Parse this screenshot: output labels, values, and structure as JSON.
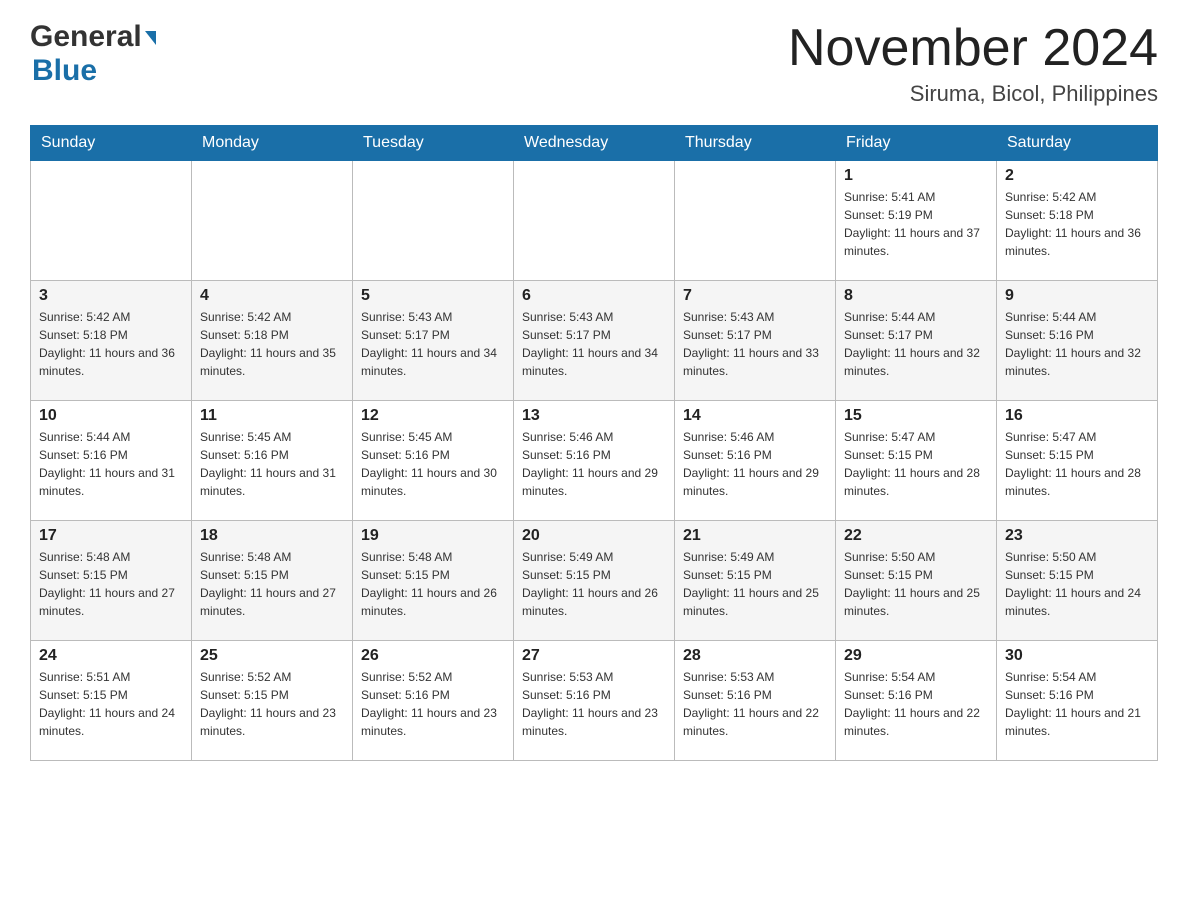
{
  "header": {
    "logo_general": "General",
    "logo_blue": "Blue",
    "month_title": "November 2024",
    "location": "Siruma, Bicol, Philippines"
  },
  "weekdays": [
    "Sunday",
    "Monday",
    "Tuesday",
    "Wednesday",
    "Thursday",
    "Friday",
    "Saturday"
  ],
  "weeks": [
    [
      {
        "day": "",
        "sunrise": "",
        "sunset": "",
        "daylight": ""
      },
      {
        "day": "",
        "sunrise": "",
        "sunset": "",
        "daylight": ""
      },
      {
        "day": "",
        "sunrise": "",
        "sunset": "",
        "daylight": ""
      },
      {
        "day": "",
        "sunrise": "",
        "sunset": "",
        "daylight": ""
      },
      {
        "day": "",
        "sunrise": "",
        "sunset": "",
        "daylight": ""
      },
      {
        "day": "1",
        "sunrise": "Sunrise: 5:41 AM",
        "sunset": "Sunset: 5:19 PM",
        "daylight": "Daylight: 11 hours and 37 minutes."
      },
      {
        "day": "2",
        "sunrise": "Sunrise: 5:42 AM",
        "sunset": "Sunset: 5:18 PM",
        "daylight": "Daylight: 11 hours and 36 minutes."
      }
    ],
    [
      {
        "day": "3",
        "sunrise": "Sunrise: 5:42 AM",
        "sunset": "Sunset: 5:18 PM",
        "daylight": "Daylight: 11 hours and 36 minutes."
      },
      {
        "day": "4",
        "sunrise": "Sunrise: 5:42 AM",
        "sunset": "Sunset: 5:18 PM",
        "daylight": "Daylight: 11 hours and 35 minutes."
      },
      {
        "day": "5",
        "sunrise": "Sunrise: 5:43 AM",
        "sunset": "Sunset: 5:17 PM",
        "daylight": "Daylight: 11 hours and 34 minutes."
      },
      {
        "day": "6",
        "sunrise": "Sunrise: 5:43 AM",
        "sunset": "Sunset: 5:17 PM",
        "daylight": "Daylight: 11 hours and 34 minutes."
      },
      {
        "day": "7",
        "sunrise": "Sunrise: 5:43 AM",
        "sunset": "Sunset: 5:17 PM",
        "daylight": "Daylight: 11 hours and 33 minutes."
      },
      {
        "day": "8",
        "sunrise": "Sunrise: 5:44 AM",
        "sunset": "Sunset: 5:17 PM",
        "daylight": "Daylight: 11 hours and 32 minutes."
      },
      {
        "day": "9",
        "sunrise": "Sunrise: 5:44 AM",
        "sunset": "Sunset: 5:16 PM",
        "daylight": "Daylight: 11 hours and 32 minutes."
      }
    ],
    [
      {
        "day": "10",
        "sunrise": "Sunrise: 5:44 AM",
        "sunset": "Sunset: 5:16 PM",
        "daylight": "Daylight: 11 hours and 31 minutes."
      },
      {
        "day": "11",
        "sunrise": "Sunrise: 5:45 AM",
        "sunset": "Sunset: 5:16 PM",
        "daylight": "Daylight: 11 hours and 31 minutes."
      },
      {
        "day": "12",
        "sunrise": "Sunrise: 5:45 AM",
        "sunset": "Sunset: 5:16 PM",
        "daylight": "Daylight: 11 hours and 30 minutes."
      },
      {
        "day": "13",
        "sunrise": "Sunrise: 5:46 AM",
        "sunset": "Sunset: 5:16 PM",
        "daylight": "Daylight: 11 hours and 29 minutes."
      },
      {
        "day": "14",
        "sunrise": "Sunrise: 5:46 AM",
        "sunset": "Sunset: 5:16 PM",
        "daylight": "Daylight: 11 hours and 29 minutes."
      },
      {
        "day": "15",
        "sunrise": "Sunrise: 5:47 AM",
        "sunset": "Sunset: 5:15 PM",
        "daylight": "Daylight: 11 hours and 28 minutes."
      },
      {
        "day": "16",
        "sunrise": "Sunrise: 5:47 AM",
        "sunset": "Sunset: 5:15 PM",
        "daylight": "Daylight: 11 hours and 28 minutes."
      }
    ],
    [
      {
        "day": "17",
        "sunrise": "Sunrise: 5:48 AM",
        "sunset": "Sunset: 5:15 PM",
        "daylight": "Daylight: 11 hours and 27 minutes."
      },
      {
        "day": "18",
        "sunrise": "Sunrise: 5:48 AM",
        "sunset": "Sunset: 5:15 PM",
        "daylight": "Daylight: 11 hours and 27 minutes."
      },
      {
        "day": "19",
        "sunrise": "Sunrise: 5:48 AM",
        "sunset": "Sunset: 5:15 PM",
        "daylight": "Daylight: 11 hours and 26 minutes."
      },
      {
        "day": "20",
        "sunrise": "Sunrise: 5:49 AM",
        "sunset": "Sunset: 5:15 PM",
        "daylight": "Daylight: 11 hours and 26 minutes."
      },
      {
        "day": "21",
        "sunrise": "Sunrise: 5:49 AM",
        "sunset": "Sunset: 5:15 PM",
        "daylight": "Daylight: 11 hours and 25 minutes."
      },
      {
        "day": "22",
        "sunrise": "Sunrise: 5:50 AM",
        "sunset": "Sunset: 5:15 PM",
        "daylight": "Daylight: 11 hours and 25 minutes."
      },
      {
        "day": "23",
        "sunrise": "Sunrise: 5:50 AM",
        "sunset": "Sunset: 5:15 PM",
        "daylight": "Daylight: 11 hours and 24 minutes."
      }
    ],
    [
      {
        "day": "24",
        "sunrise": "Sunrise: 5:51 AM",
        "sunset": "Sunset: 5:15 PM",
        "daylight": "Daylight: 11 hours and 24 minutes."
      },
      {
        "day": "25",
        "sunrise": "Sunrise: 5:52 AM",
        "sunset": "Sunset: 5:15 PM",
        "daylight": "Daylight: 11 hours and 23 minutes."
      },
      {
        "day": "26",
        "sunrise": "Sunrise: 5:52 AM",
        "sunset": "Sunset: 5:16 PM",
        "daylight": "Daylight: 11 hours and 23 minutes."
      },
      {
        "day": "27",
        "sunrise": "Sunrise: 5:53 AM",
        "sunset": "Sunset: 5:16 PM",
        "daylight": "Daylight: 11 hours and 23 minutes."
      },
      {
        "day": "28",
        "sunrise": "Sunrise: 5:53 AM",
        "sunset": "Sunset: 5:16 PM",
        "daylight": "Daylight: 11 hours and 22 minutes."
      },
      {
        "day": "29",
        "sunrise": "Sunrise: 5:54 AM",
        "sunset": "Sunset: 5:16 PM",
        "daylight": "Daylight: 11 hours and 22 minutes."
      },
      {
        "day": "30",
        "sunrise": "Sunrise: 5:54 AM",
        "sunset": "Sunset: 5:16 PM",
        "daylight": "Daylight: 11 hours and 21 minutes."
      }
    ]
  ]
}
